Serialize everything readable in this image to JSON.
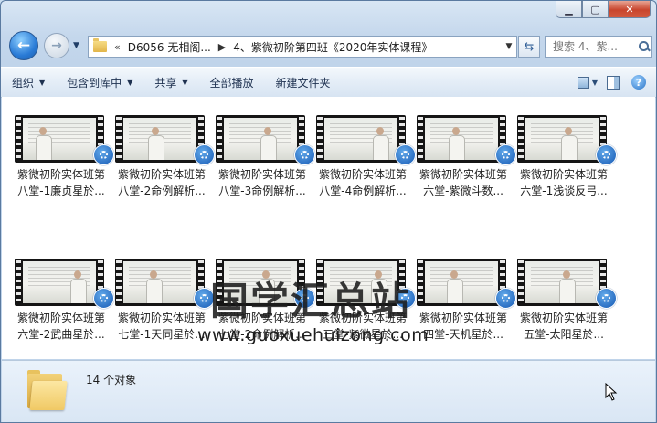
{
  "breadcrumb": {
    "overflow": "«",
    "segments": [
      "D6056 无相阁...",
      "4、紫微初阶第四班《2020年实体课程》"
    ]
  },
  "search": {
    "placeholder": "搜索 4、紫..."
  },
  "toolbar": {
    "organize": "组织",
    "include_library": "包含到库中",
    "share": "共享",
    "play_all": "全部播放",
    "new_folder": "新建文件夹"
  },
  "files": [
    {
      "line1": "紫微初阶实体班第",
      "line2": "八堂-1廉贞星於..."
    },
    {
      "line1": "紫微初阶实体班第",
      "line2": "八堂-2命例解析..."
    },
    {
      "line1": "紫微初阶实体班第",
      "line2": "八堂-3命例解析..."
    },
    {
      "line1": "紫微初阶实体班第",
      "line2": "八堂-4命例解析..."
    },
    {
      "line1": "紫微初阶实体班第",
      "line2": "六堂-紫微斗数..."
    },
    {
      "line1": "紫微初阶实体班第",
      "line2": "六堂-1浅谈反弓..."
    },
    {
      "line1": "紫微初阶实体班第",
      "line2": "六堂-2武曲星於..."
    },
    {
      "line1": "紫微初阶实体班第",
      "line2": "七堂-1天同星於..."
    },
    {
      "line1": "紫微初阶实体班第",
      "line2": "七堂-2命例解析..."
    },
    {
      "line1": "紫微初阶实体班第",
      "line2": "三堂-紫微星於..."
    },
    {
      "line1": "紫微初阶实体班第",
      "line2": "四堂-天机星於..."
    },
    {
      "line1": "紫微初阶实体班第",
      "line2": "五堂-太阳星於..."
    }
  ],
  "watermark": {
    "text": "国学汇总站",
    "url": "www.guoxuehuizong.com"
  },
  "status": {
    "count": "14 个对象"
  }
}
